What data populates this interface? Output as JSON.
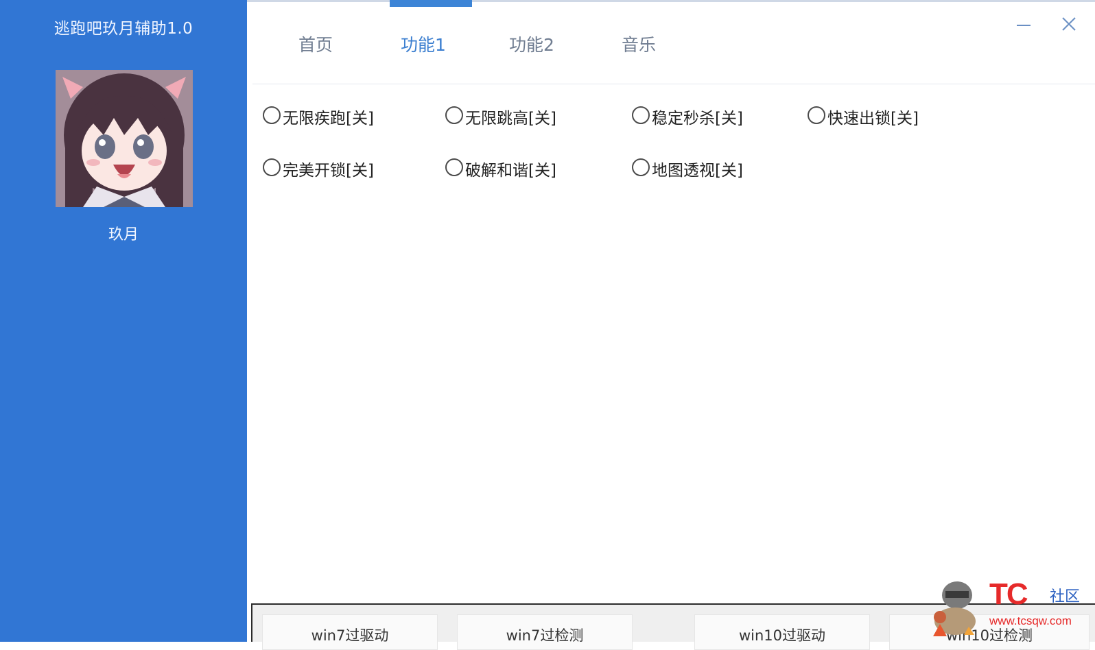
{
  "app": {
    "title": "逃跑吧玖月辅助1.0",
    "user_name": "玖月"
  },
  "tabs": [
    {
      "label": "首页",
      "active": false
    },
    {
      "label": "功能1",
      "active": true
    },
    {
      "label": "功能2",
      "active": false
    },
    {
      "label": "音乐",
      "active": false
    }
  ],
  "window_controls": {
    "minimize_icon": "minimize-icon",
    "close_icon": "close-icon"
  },
  "options": [
    {
      "label": "无限疾跑[关]",
      "checked": false
    },
    {
      "label": "无限跳高[关]",
      "checked": false
    },
    {
      "label": "稳定秒杀[关]",
      "checked": false
    },
    {
      "label": "快速出锁[关]",
      "checked": false
    },
    {
      "label": "完美开锁[关]",
      "checked": false
    },
    {
      "label": "破解和谐[关]",
      "checked": false
    },
    {
      "label": "地图透视[关]",
      "checked": false
    }
  ],
  "bottom_buttons": [
    {
      "label": "win7过驱动"
    },
    {
      "label": "win7过检测"
    },
    {
      "label": "win10过驱动"
    },
    {
      "label": "win10过检测"
    }
  ],
  "watermark": {
    "logo": "TC",
    "text": "社区",
    "url": "www.tcsqw.com"
  },
  "colors": {
    "sidebar": "#3176d4",
    "accent": "#3c84d6"
  }
}
